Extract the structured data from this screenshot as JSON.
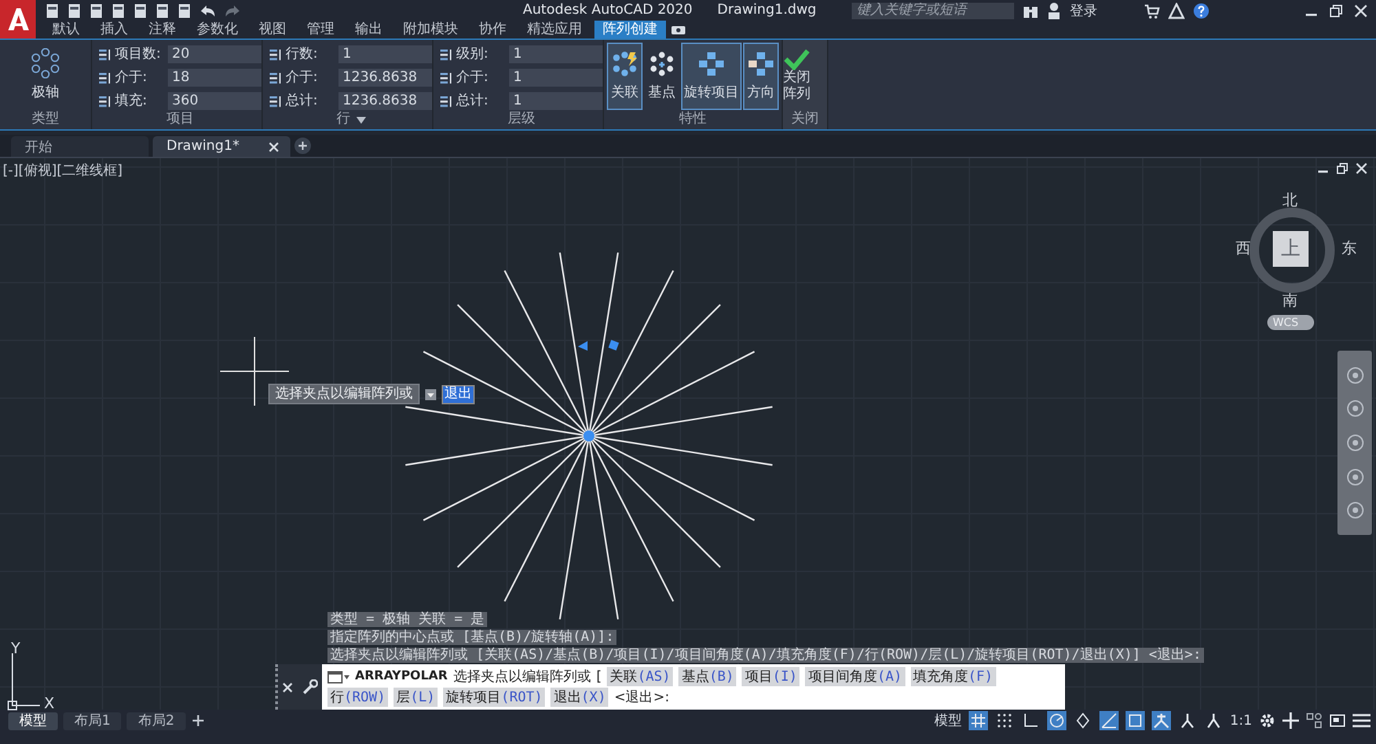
{
  "title_bar": {
    "app_title": "Autodesk AutoCAD 2020",
    "file_name": "Drawing1.dwg",
    "search": {
      "placeholder": "键入关键字或短语"
    },
    "sign_in": "登录"
  },
  "ribbon_tabs": [
    {
      "label": "默认",
      "selected": false
    },
    {
      "label": "插入",
      "selected": false
    },
    {
      "label": "注释",
      "selected": false
    },
    {
      "label": "参数化",
      "selected": false
    },
    {
      "label": "视图",
      "selected": false
    },
    {
      "label": "管理",
      "selected": false
    },
    {
      "label": "输出",
      "selected": false
    },
    {
      "label": "附加模块",
      "selected": false
    },
    {
      "label": "协作",
      "selected": false
    },
    {
      "label": "精选应用",
      "selected": false
    },
    {
      "label": "阵列创建",
      "selected": true
    }
  ],
  "ribbon": {
    "type_panel": {
      "button": "极轴",
      "title": "类型"
    },
    "field_panels": [
      {
        "title": "项目",
        "has_menu": false,
        "fields": [
          {
            "label": "项目数:",
            "value": "20"
          },
          {
            "label": "介于:",
            "value": "18"
          },
          {
            "label": "填充:",
            "value": "360"
          }
        ]
      },
      {
        "title": "行",
        "has_menu": true,
        "fields": [
          {
            "label": "行数:",
            "value": "1"
          },
          {
            "label": "介于:",
            "value": "1236.8638"
          },
          {
            "label": "总计:",
            "value": "1236.8638"
          }
        ]
      },
      {
        "title": "层级",
        "has_menu": false,
        "fields": [
          {
            "label": "级别:",
            "value": "1"
          },
          {
            "label": "介于:",
            "value": "1"
          },
          {
            "label": "总计:",
            "value": "1"
          }
        ]
      }
    ],
    "properties_panel": {
      "title": "特性",
      "buttons": [
        {
          "label": "关联",
          "kind": "associative",
          "selected": true
        },
        {
          "label": "基点",
          "kind": "base-point",
          "selected": false
        },
        {
          "label": "旋转项目",
          "kind": "rotate",
          "selected": true
        },
        {
          "label": "方向",
          "kind": "direction",
          "selected": true
        }
      ]
    },
    "close_panel": {
      "button": [
        "关闭",
        "阵列"
      ],
      "title": "关闭"
    }
  },
  "doc_tabs": [
    {
      "label": "开始",
      "selected": false
    },
    {
      "label": "Drawing1*",
      "selected": true
    }
  ],
  "viewport": {
    "label": "[-][俯视][二维线框]",
    "viewcube": {
      "north": "北",
      "south": "南",
      "east": "东",
      "west": "西",
      "top": "上",
      "ucs": "WCS"
    },
    "tooltip": {
      "prompt": "选择夹点以编辑阵列或",
      "input": "退出"
    },
    "ucs_icon": {
      "x": "X",
      "y": "Y"
    },
    "command_history": [
      "类型 = 极轴  关联 = 是",
      "指定阵列的中心点或 [基点(B)/旋转轴(A)]:",
      "选择夹点以编辑阵列或 [关联(AS)/基点(B)/项目(I)/项目间角度(A)/填充角度(F)/行(ROW)/层(L)/旋转项目(ROT)/退出(X)] <退出>:"
    ],
    "command_line": {
      "command": "ARRAYPOLAR",
      "prompt": "选择夹点以编辑阵列或",
      "bracket": "[",
      "options": [
        {
          "label": "关联",
          "key": "(AS)"
        },
        {
          "label": "基点",
          "key": "(B)"
        },
        {
          "label": "项目",
          "key": "(I)"
        },
        {
          "label": "项目间角度",
          "key": "(A)"
        },
        {
          "label": "填充角度",
          "key": "(F)"
        },
        {
          "label": "行",
          "key": "(ROW)"
        },
        {
          "label": "层",
          "key": "(L)"
        },
        {
          "label": "旋转项目",
          "key": "(ROT)"
        },
        {
          "label": "退出",
          "key": "(X)"
        }
      ],
      "default": "<退出>:"
    }
  },
  "layout_tabs": [
    {
      "label": "模型",
      "selected": true
    },
    {
      "label": "布局1",
      "selected": false
    },
    {
      "label": "布局2",
      "selected": false
    }
  ],
  "status_bar": {
    "model_label": "模型",
    "toggles": [
      {
        "kind": "grid",
        "on": true
      },
      {
        "kind": "snap",
        "on": false
      },
      {
        "kind": "ortho",
        "on": false
      },
      {
        "kind": "polar",
        "on": true
      },
      {
        "kind": "isodraft",
        "on": false
      },
      {
        "kind": "tracking",
        "on": true
      },
      {
        "kind": "osnap",
        "on": true
      },
      {
        "kind": "annotation",
        "on": true
      },
      {
        "kind": "autoscale",
        "on": false
      },
      {
        "kind": "annoscale",
        "on": false
      }
    ],
    "scale": "1:1"
  }
}
